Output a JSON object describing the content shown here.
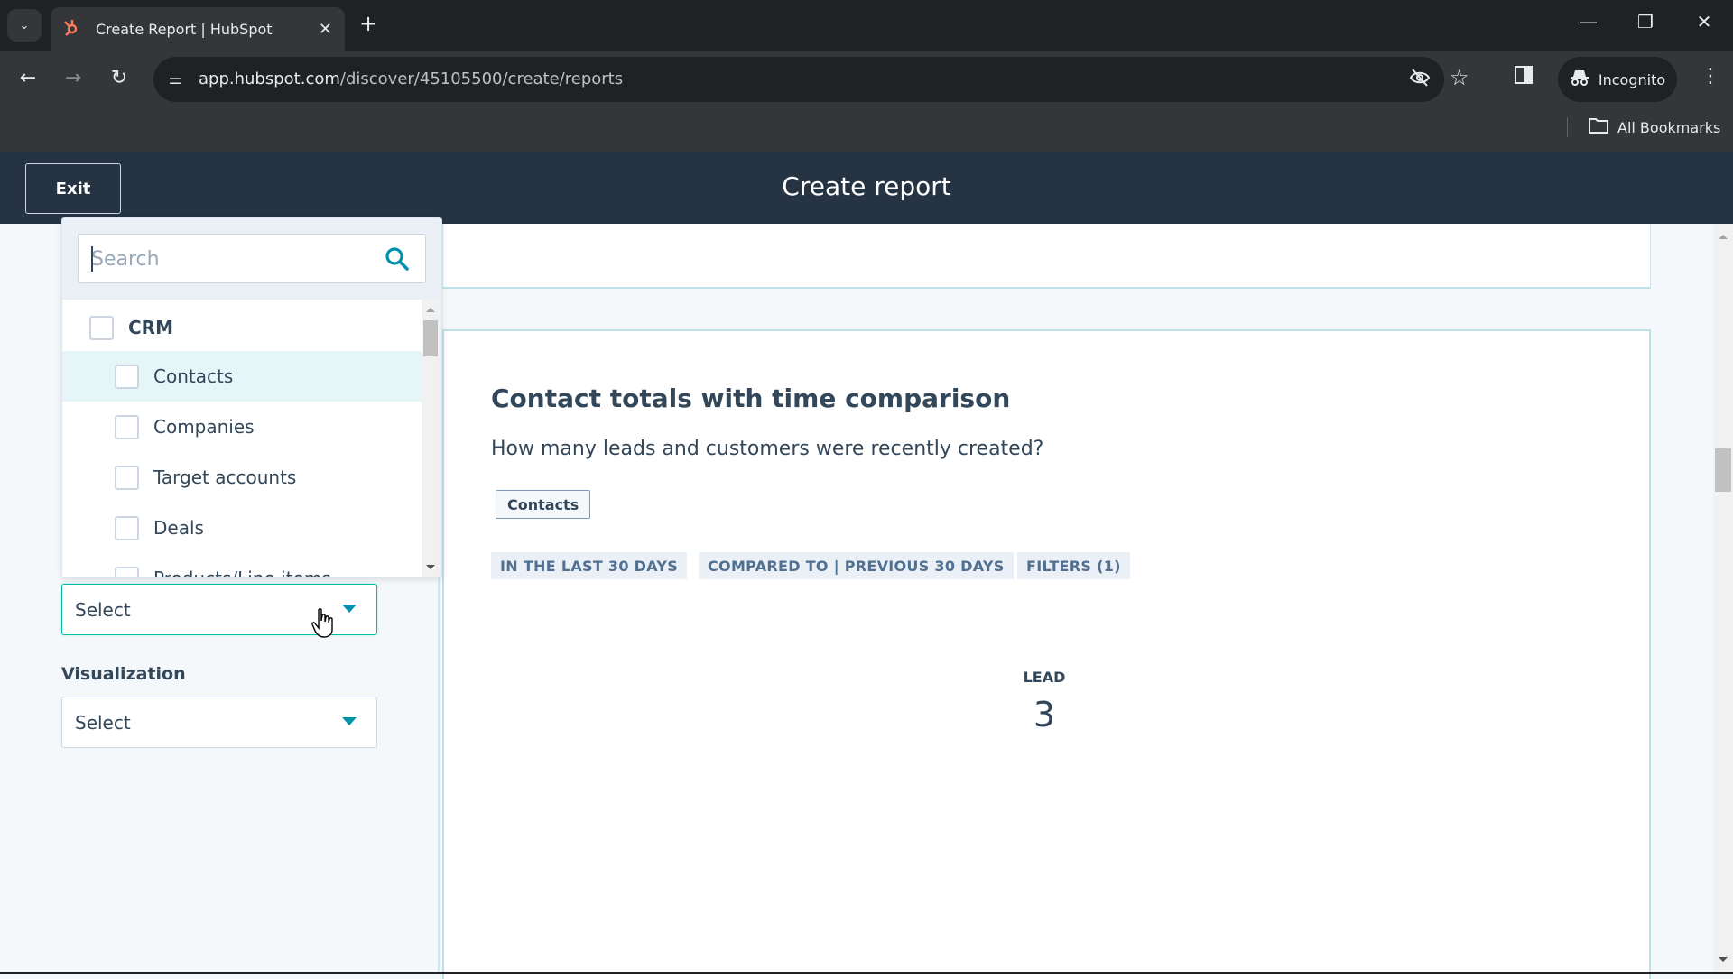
{
  "browser": {
    "tab_title": "Create Report | HubSpot",
    "new_tab": "+",
    "url_host": "app.hubspot.com",
    "url_path": "/discover/45105500/create/reports",
    "profile_label": "Incognito",
    "bookmarks_label": "All Bookmarks",
    "window_controls": {
      "minimize": "—",
      "restore": "❐",
      "close": "✕"
    }
  },
  "header": {
    "exit_label": "Exit",
    "title": "Create report"
  },
  "data_source_dropdown": {
    "search_placeholder": "Search",
    "search_value": "",
    "items": [
      {
        "label": "CRM",
        "type": "group",
        "checked": false
      },
      {
        "label": "Contacts",
        "type": "item",
        "checked": false,
        "highlighted": true
      },
      {
        "label": "Companies",
        "type": "item",
        "checked": false
      },
      {
        "label": "Target accounts",
        "type": "item",
        "checked": false
      },
      {
        "label": "Deals",
        "type": "item",
        "checked": false
      },
      {
        "label": "Products/Line items",
        "type": "item",
        "checked": false
      }
    ]
  },
  "left_panel": {
    "data_source_select": {
      "value": "Select"
    },
    "visualization_label": "Visualization",
    "visualization_select": {
      "value": "Select"
    }
  },
  "report_card": {
    "title": "Contact totals with time comparison",
    "subtitle": "How many leads and customers were recently created?",
    "object_tag": "Contacts",
    "pills": [
      "IN THE LAST 30 DAYS",
      "COMPARED TO | PREVIOUS 30 DAYS",
      "FILTERS (1)"
    ],
    "kpi": {
      "label": "LEAD",
      "value": "3"
    }
  },
  "colors": {
    "header_bg": "#253342",
    "accent_teal": "#0091ae",
    "text_primary": "#33475b",
    "pill_bg": "#eaf0f6",
    "hubspot_orange": "#ff7a59"
  }
}
